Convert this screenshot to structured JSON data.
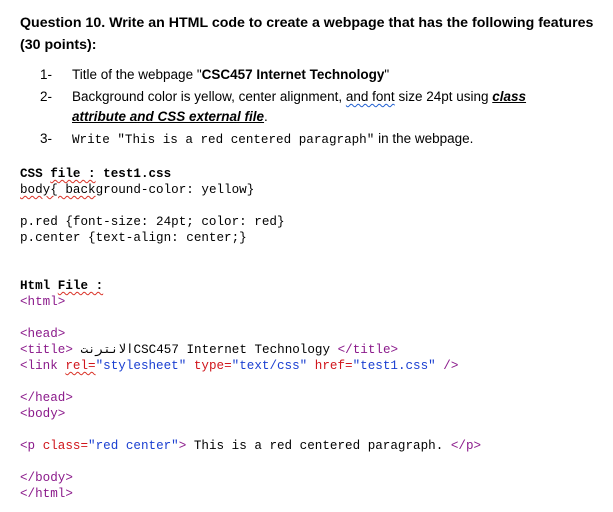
{
  "question": {
    "title": "Question 10. Write an HTML code to create a webpage that has the following features (30 points):",
    "items": [
      {
        "num": "1-",
        "text_a": "Title of the webpage \"",
        "bold": "CSC457 Internet Technology",
        "text_b": "\""
      },
      {
        "num": "2-",
        "text_a": "Background color is yellow, center alignment, ",
        "wavy": "and  font",
        "text_b": " size 24pt using ",
        "bi1": "class",
        "line2_bi": "attribute and  CSS external file",
        "line2_end": "."
      },
      {
        "num": "3-",
        "text_a": "Write \"This is a red centered paragraph\"",
        "text_b": " in the webpage."
      }
    ]
  },
  "css_section": {
    "header_a": "CSS ",
    "header_file": "file :",
    "header_b": " test1.css",
    "line1_a": "body{ back",
    "line1_b": "ground-color: yellow}",
    "line2": "p.red {font-size: 24pt; color: red}",
    "line3": "p.center {text-align: center;}"
  },
  "html_section": {
    "header_a": "Html ",
    "header_file": "File :",
    "lines": {
      "html_open": "<html>",
      "head_open": "<head>",
      "title_open": "<title> ",
      "title_text": "الانترنتCSC457 Internet Technology ",
      "title_close": "</title>",
      "link_tag": "<link ",
      "rel_attr": "rel=",
      "rel_val": "\"stylesheet\"",
      "type_attr": " type=",
      "type_val": "\"text/css\"",
      "href_attr": " href=",
      "href_val": "\"test1.css\"",
      "link_close": " />",
      "head_close": "</head>",
      "body_open": "<body>",
      "p_open": "<p ",
      "class_attr": "class=",
      "class_val": "\"red center\"",
      "p_gt": ">",
      "p_text": " This is a red centered paragraph. ",
      "p_close": "</p>",
      "body_close": "</body>",
      "html_close": "</html>"
    }
  }
}
